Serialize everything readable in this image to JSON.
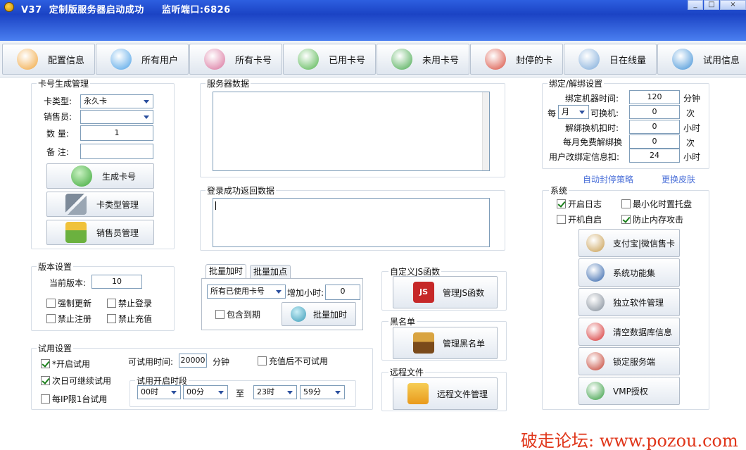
{
  "window": {
    "title": "V37  定制版服务器启动成功     监听端口:6826",
    "minimize": "_",
    "maximize": "□",
    "close": "×"
  },
  "toolbar": {
    "items": [
      {
        "label": "配置信息",
        "icon": "user-key-icon"
      },
      {
        "label": "所有用户",
        "icon": "users-icon"
      },
      {
        "label": "所有卡号",
        "icon": "users-group-icon"
      },
      {
        "label": "已用卡号",
        "icon": "user-check-icon"
      },
      {
        "label": "未用卡号",
        "icon": "user-add-icon"
      },
      {
        "label": "封停的卡",
        "icon": "user-block-icon"
      },
      {
        "label": "日在线量",
        "icon": "search-icon"
      },
      {
        "label": "试用信息",
        "icon": "chat-icon"
      }
    ]
  },
  "card_gen": {
    "group": "卡号生成管理",
    "type_label": "卡类型:",
    "type_value": "永久卡",
    "seller_label": "销售员:",
    "seller_value": "",
    "qty_label": "数 量:",
    "qty_value": "1",
    "note_label": "备 注:",
    "note_value": "",
    "gen_button": "生成卡号",
    "type_mgr_button": "卡类型管理",
    "seller_mgr_button": "销售员管理"
  },
  "server_data": {
    "group": "服务器数据",
    "login_group": "登录成功返回数据"
  },
  "version": {
    "group": "版本设置",
    "current_label": "当前版本:",
    "current_value": "10",
    "force_update": "强制更新",
    "no_login": "禁止登录",
    "no_register": "禁止注册",
    "no_recharge": "禁止充值"
  },
  "batch": {
    "tab1": "批量加时",
    "tab2": "批量加点",
    "scope_value": "所有已使用卡号",
    "add_hours_label": "增加小时:",
    "add_hours_value": "0",
    "include_expired": "包含到期",
    "batch_button": "批量加时"
  },
  "trial": {
    "group": "试用设置",
    "enable": "*开启试用",
    "next_day": "次日可继续试用",
    "ip_limit": "每IP限1台试用",
    "time_label": "可试用时间:",
    "time_value": "20000",
    "time_unit": "分钟",
    "no_after_recharge": "充值后不可试用",
    "period_group": "试用开启时段",
    "start_hour": "00时",
    "start_min": "00分",
    "to": "至",
    "end_hour": "23时",
    "end_min": "59分"
  },
  "js": {
    "group": "自定义JS函数",
    "button": "管理JS函数"
  },
  "blacklist": {
    "group": "黑名单",
    "button": "管理黑名单"
  },
  "remote": {
    "group": "远程文件",
    "button": "远程文件管理"
  },
  "binding": {
    "group": "绑定/解绑设置",
    "machine_time_label": "绑定机器时间:",
    "machine_time_value": "120",
    "machine_time_unit": "分钟",
    "per_label": "每",
    "per_value": "月",
    "changeable_label": "可换机:",
    "changeable_value": "0",
    "changeable_unit": "次",
    "unbind_deduct_label": "解绑换机扣时:",
    "unbind_deduct_value": "0",
    "unbind_deduct_unit": "小时",
    "free_unbind_label": "每月免费解绑换",
    "free_unbind_value": "0",
    "free_unbind_unit": "次",
    "user_change_label": "用户改绑定信息扣:",
    "user_change_value": "24",
    "user_change_unit": "小时",
    "auto_ban_link": "自动封停策略",
    "change_skin_link": "更换皮肤"
  },
  "system": {
    "group": "系统",
    "open_log": "开启日志",
    "minimize_tray": "最小化时置托盘",
    "auto_start": "开机自启",
    "anti_memory": "防止内存攻击",
    "buttons": [
      "支付宝|微信售卡",
      "系统功能集",
      "独立软件管理",
      "清空数据库信息",
      "锁定服务端",
      "VMP授权"
    ]
  },
  "watermark": "破走论坛: www.pozou.com"
}
